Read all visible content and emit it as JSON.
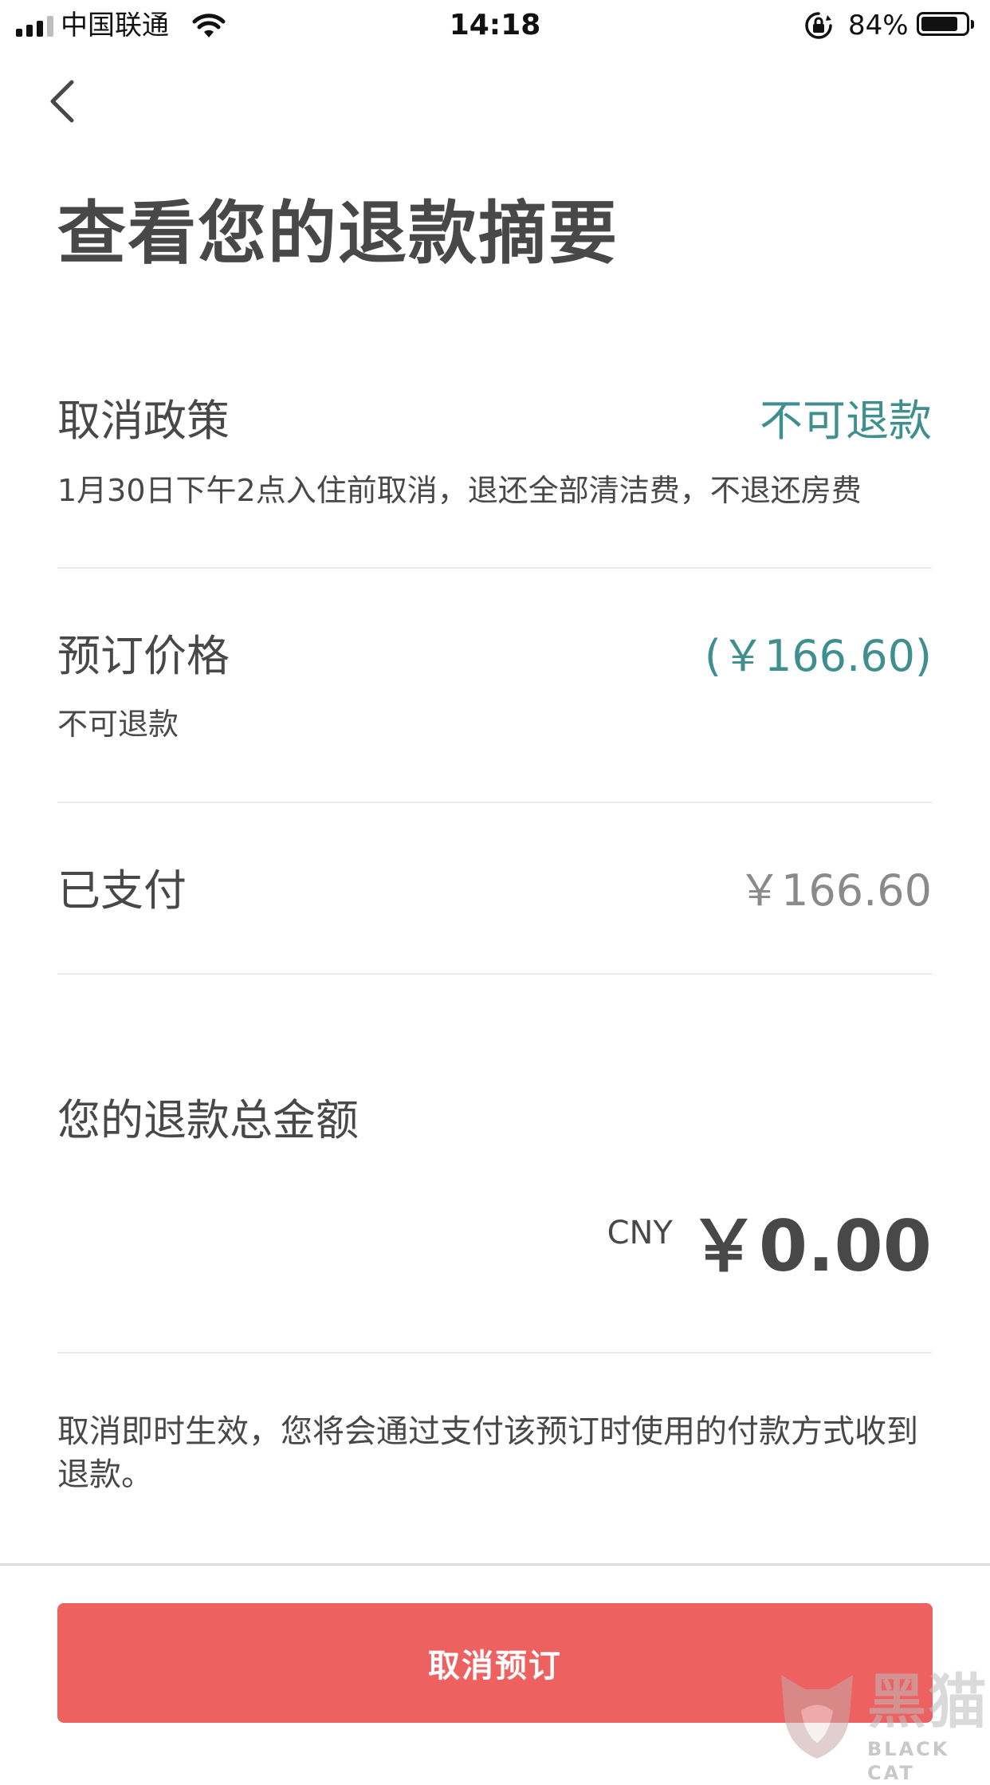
{
  "status_bar": {
    "carrier": "中国联通",
    "time": "14:18",
    "battery_percent_text": "84%",
    "battery_level": 0.84
  },
  "header": {
    "back_icon": "chevron-left-icon",
    "title": "查看您的退款摘要"
  },
  "summary": {
    "policy": {
      "label": "取消政策",
      "value": "不可退款",
      "detail": "1月30日下午2点入住前取消，退还全部清洁费，不退还房费"
    },
    "booking_price": {
      "label": "预订价格",
      "value": "(￥166.60)",
      "detail": "不可退款"
    },
    "paid": {
      "label": "已支付",
      "value": "￥166.60"
    }
  },
  "total": {
    "label": "您的退款总金额",
    "currency": "CNY",
    "value": "￥0.00"
  },
  "note": "取消即时生效，您将会通过支付该预订时使用的付款方式收到退款。",
  "action": {
    "cancel_label": "取消预订"
  },
  "watermark": {
    "text": "黑猫",
    "sub": "BLACK CAT"
  },
  "colors": {
    "accent_teal": "#3f8f8f",
    "button_red": "#ee6161",
    "text_dark": "#484848",
    "text_grey": "#8a8a8a"
  }
}
